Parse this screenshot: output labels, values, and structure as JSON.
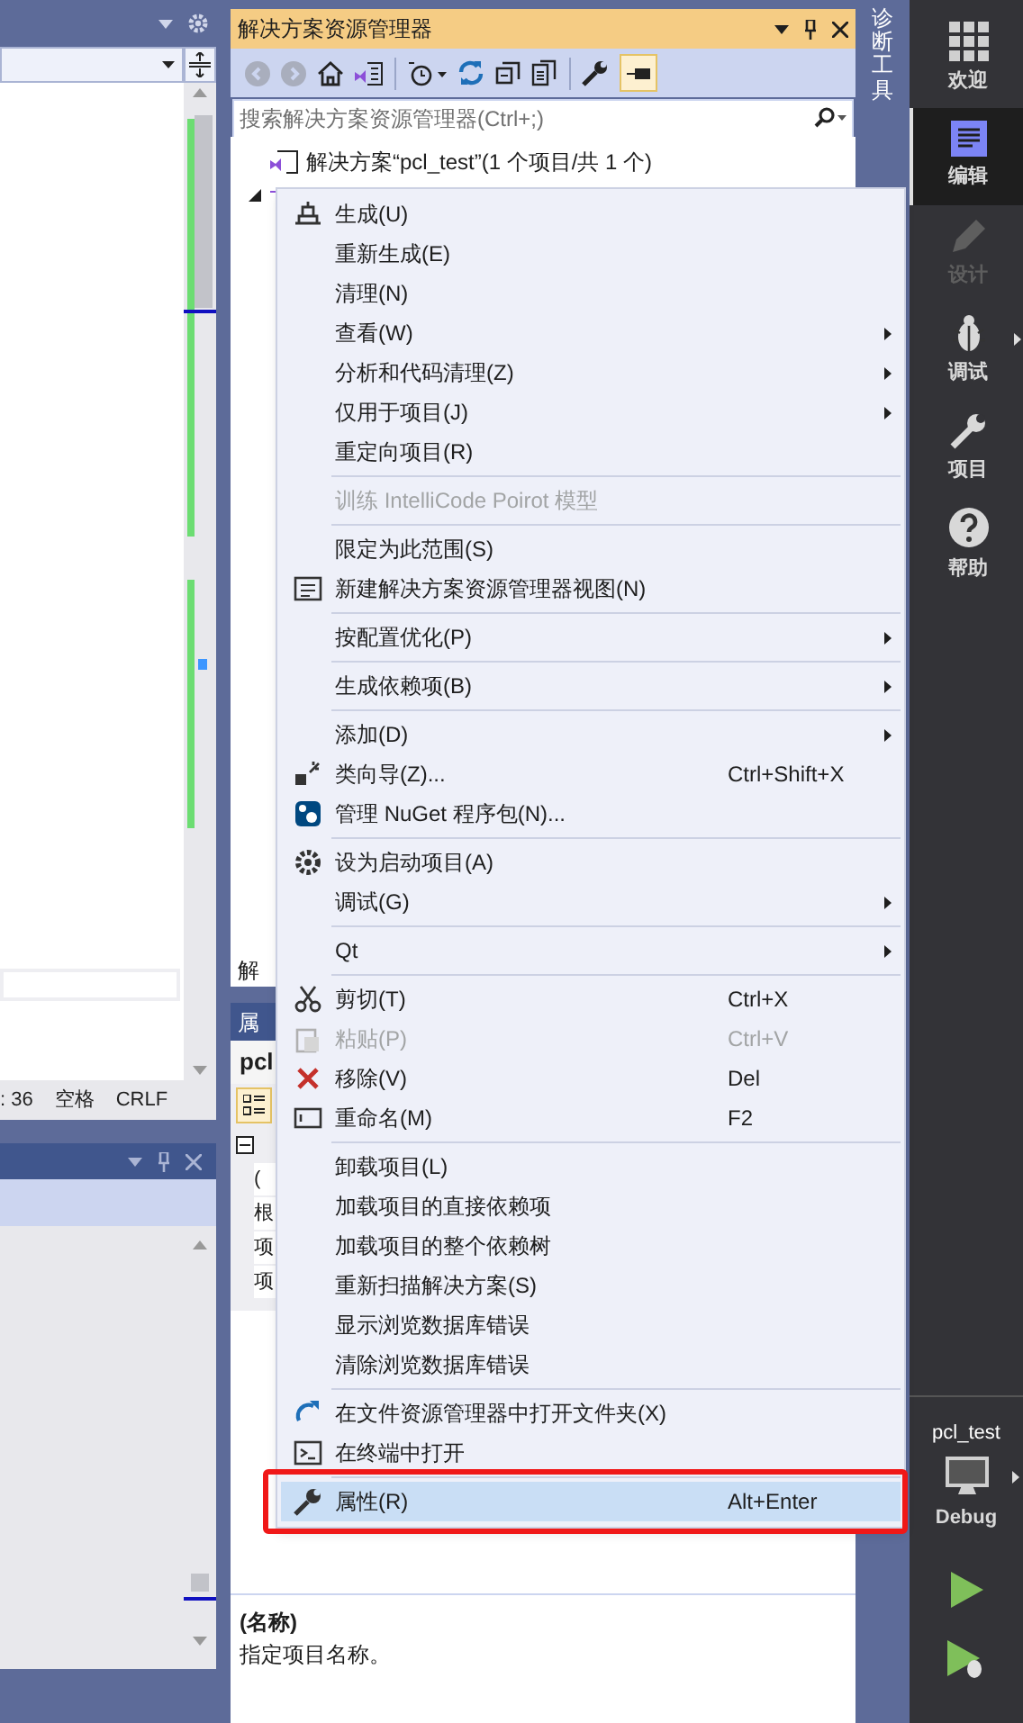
{
  "editor": {
    "status": [
      ": 36",
      "空格",
      "CRLF"
    ]
  },
  "solution_explorer": {
    "title": "解决方案资源管理器",
    "search": {
      "placeholder": "搜索解决方案资源管理器(Ctrl+;)"
    },
    "tree": [
      {
        "kind": "solution",
        "label": "解决方案“pcl_test”(1 个项目/共 1 个)",
        "expanded": false
      },
      {
        "kind": "project",
        "expanded": true
      }
    ],
    "bottom_tab": "解"
  },
  "properties": {
    "title": "属",
    "object": "pcl",
    "rows": [
      "(",
      "根",
      "项",
      "项"
    ],
    "description_title": "(名称)",
    "description": "指定项目名称。"
  },
  "vertical_tab": "诊断工具",
  "context_menu": {
    "annotation_box": true,
    "items": [
      {
        "kind": "build",
        "label": "生成(U)",
        "submenu": false,
        "disabled": false,
        "selected": false
      },
      {
        "kind": "plain",
        "label": "重新生成(E)",
        "submenu": false,
        "disabled": false,
        "selected": false
      },
      {
        "kind": "plain",
        "label": "清理(N)",
        "submenu": false,
        "disabled": false,
        "selected": false
      },
      {
        "kind": "plain",
        "label": "查看(W)",
        "submenu": true,
        "disabled": false,
        "selected": false
      },
      {
        "kind": "plain",
        "label": "分析和代码清理(Z)",
        "submenu": true,
        "disabled": false,
        "selected": false
      },
      {
        "kind": "plain",
        "label": "仅用于项目(J)",
        "submenu": true,
        "disabled": false,
        "selected": false
      },
      {
        "kind": "plain",
        "label": "重定向项目(R)",
        "submenu": false,
        "disabled": false,
        "selected": false
      },
      {
        "kind": "separator"
      },
      {
        "kind": "plain",
        "label": "训练 IntelliCode Poirot 模型",
        "submenu": false,
        "disabled": true,
        "selected": false
      },
      {
        "kind": "separator"
      },
      {
        "kind": "plain",
        "label": "限定为此范围(S)",
        "submenu": false,
        "disabled": false,
        "selected": false
      },
      {
        "kind": "view",
        "label": "新建解决方案资源管理器视图(N)",
        "submenu": false,
        "disabled": false,
        "selected": false
      },
      {
        "kind": "separator"
      },
      {
        "kind": "plain",
        "label": "按配置优化(P)",
        "submenu": true,
        "disabled": false,
        "selected": false
      },
      {
        "kind": "separator"
      },
      {
        "kind": "plain",
        "label": "生成依赖项(B)",
        "submenu": true,
        "disabled": false,
        "selected": false
      },
      {
        "kind": "separator"
      },
      {
        "kind": "plain",
        "label": "添加(D)",
        "submenu": true,
        "disabled": false,
        "selected": false
      },
      {
        "kind": "wizard",
        "label": "类向导(Z)...",
        "shortcut": "Ctrl+Shift+X",
        "submenu": false,
        "disabled": false,
        "selected": false
      },
      {
        "kind": "nuget",
        "label": "管理 NuGet 程序包(N)...",
        "submenu": false,
        "disabled": false,
        "selected": false
      },
      {
        "kind": "separator"
      },
      {
        "kind": "startup",
        "label": "设为启动项目(A)",
        "submenu": false,
        "disabled": false,
        "selected": false
      },
      {
        "kind": "plain",
        "label": "调试(G)",
        "submenu": true,
        "disabled": false,
        "selected": false
      },
      {
        "kind": "separator"
      },
      {
        "kind": "plain",
        "label": "Qt",
        "submenu": true,
        "disabled": false,
        "selected": false
      },
      {
        "kind": "separator"
      },
      {
        "kind": "cut",
        "label": "剪切(T)",
        "shortcut": "Ctrl+X",
        "submenu": false,
        "disabled": false,
        "selected": false
      },
      {
        "kind": "paste",
        "label": "粘贴(P)",
        "shortcut": "Ctrl+V",
        "submenu": false,
        "disabled": true,
        "selected": false
      },
      {
        "kind": "remove",
        "label": "移除(V)",
        "shortcut": "Del",
        "submenu": false,
        "disabled": false,
        "selected": false
      },
      {
        "kind": "rename",
        "label": "重命名(M)",
        "shortcut": "F2",
        "submenu": false,
        "disabled": false,
        "selected": false
      },
      {
        "kind": "separator"
      },
      {
        "kind": "plain",
        "label": "卸载项目(L)",
        "submenu": false,
        "disabled": false,
        "selected": false
      },
      {
        "kind": "plain",
        "label": "加载项目的直接依赖项",
        "submenu": false,
        "disabled": false,
        "selected": false
      },
      {
        "kind": "plain",
        "label": "加载项目的整个依赖树",
        "submenu": false,
        "disabled": false,
        "selected": false
      },
      {
        "kind": "plain",
        "label": "重新扫描解决方案(S)",
        "submenu": false,
        "disabled": false,
        "selected": false
      },
      {
        "kind": "plain",
        "label": "显示浏览数据库错误",
        "submenu": false,
        "disabled": false,
        "selected": false
      },
      {
        "kind": "plain",
        "label": "清除浏览数据库错误",
        "submenu": false,
        "disabled": false,
        "selected": false
      },
      {
        "kind": "separator"
      },
      {
        "kind": "folder",
        "label": "在文件资源管理器中打开文件夹(X)",
        "submenu": false,
        "disabled": false,
        "selected": false
      },
      {
        "kind": "terminal",
        "label": "在终端中打开",
        "submenu": false,
        "disabled": false,
        "selected": false
      },
      {
        "kind": "separator"
      },
      {
        "kind": "properties",
        "label": "属性(R)",
        "shortcut": "Alt+Enter",
        "submenu": false,
        "disabled": false,
        "selected": true
      }
    ]
  },
  "activity_bar": {
    "items": [
      {
        "kind": "grid",
        "label": "欢迎",
        "selected": false,
        "disabled": false,
        "submenu": false
      },
      {
        "kind": "editor",
        "label": "编辑",
        "selected": true,
        "disabled": false,
        "submenu": false
      },
      {
        "kind": "pencil",
        "label": "设计",
        "selected": false,
        "disabled": true,
        "submenu": false
      },
      {
        "kind": "bug",
        "label": "调试",
        "selected": false,
        "disabled": false,
        "submenu": true
      },
      {
        "kind": "wrench",
        "label": "项目",
        "selected": false,
        "disabled": false,
        "submenu": false
      },
      {
        "kind": "help",
        "label": "帮助",
        "selected": false,
        "disabled": false,
        "submenu": false
      }
    ],
    "project": "pcl_test",
    "configuration": "Debug"
  }
}
